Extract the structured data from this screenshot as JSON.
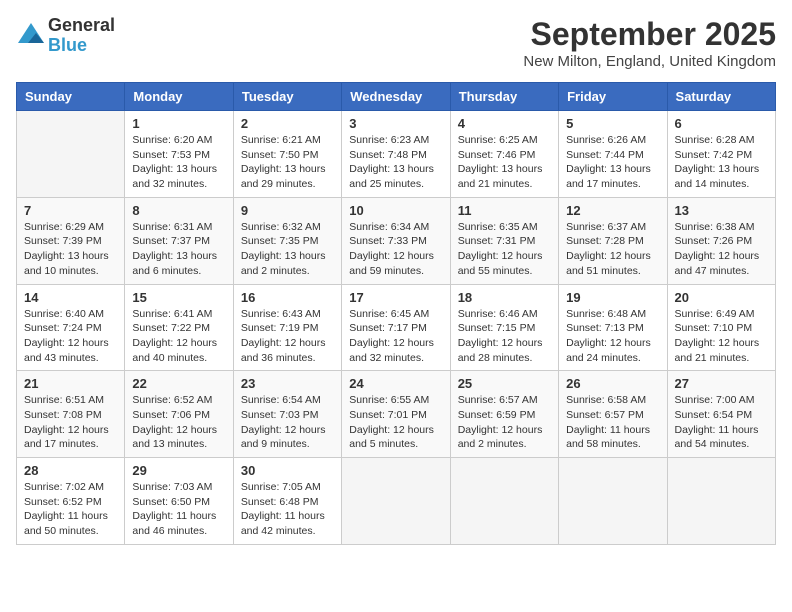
{
  "logo": {
    "general": "General",
    "blue": "Blue"
  },
  "title": "September 2025",
  "subtitle": "New Milton, England, United Kingdom",
  "headers": [
    "Sunday",
    "Monday",
    "Tuesday",
    "Wednesday",
    "Thursday",
    "Friday",
    "Saturday"
  ],
  "weeks": [
    [
      {
        "day": "",
        "info": ""
      },
      {
        "day": "1",
        "info": "Sunrise: 6:20 AM\nSunset: 7:53 PM\nDaylight: 13 hours\nand 32 minutes."
      },
      {
        "day": "2",
        "info": "Sunrise: 6:21 AM\nSunset: 7:50 PM\nDaylight: 13 hours\nand 29 minutes."
      },
      {
        "day": "3",
        "info": "Sunrise: 6:23 AM\nSunset: 7:48 PM\nDaylight: 13 hours\nand 25 minutes."
      },
      {
        "day": "4",
        "info": "Sunrise: 6:25 AM\nSunset: 7:46 PM\nDaylight: 13 hours\nand 21 minutes."
      },
      {
        "day": "5",
        "info": "Sunrise: 6:26 AM\nSunset: 7:44 PM\nDaylight: 13 hours\nand 17 minutes."
      },
      {
        "day": "6",
        "info": "Sunrise: 6:28 AM\nSunset: 7:42 PM\nDaylight: 13 hours\nand 14 minutes."
      }
    ],
    [
      {
        "day": "7",
        "info": "Sunrise: 6:29 AM\nSunset: 7:39 PM\nDaylight: 13 hours\nand 10 minutes."
      },
      {
        "day": "8",
        "info": "Sunrise: 6:31 AM\nSunset: 7:37 PM\nDaylight: 13 hours\nand 6 minutes."
      },
      {
        "day": "9",
        "info": "Sunrise: 6:32 AM\nSunset: 7:35 PM\nDaylight: 13 hours\nand 2 minutes."
      },
      {
        "day": "10",
        "info": "Sunrise: 6:34 AM\nSunset: 7:33 PM\nDaylight: 12 hours\nand 59 minutes."
      },
      {
        "day": "11",
        "info": "Sunrise: 6:35 AM\nSunset: 7:31 PM\nDaylight: 12 hours\nand 55 minutes."
      },
      {
        "day": "12",
        "info": "Sunrise: 6:37 AM\nSunset: 7:28 PM\nDaylight: 12 hours\nand 51 minutes."
      },
      {
        "day": "13",
        "info": "Sunrise: 6:38 AM\nSunset: 7:26 PM\nDaylight: 12 hours\nand 47 minutes."
      }
    ],
    [
      {
        "day": "14",
        "info": "Sunrise: 6:40 AM\nSunset: 7:24 PM\nDaylight: 12 hours\nand 43 minutes."
      },
      {
        "day": "15",
        "info": "Sunrise: 6:41 AM\nSunset: 7:22 PM\nDaylight: 12 hours\nand 40 minutes."
      },
      {
        "day": "16",
        "info": "Sunrise: 6:43 AM\nSunset: 7:19 PM\nDaylight: 12 hours\nand 36 minutes."
      },
      {
        "day": "17",
        "info": "Sunrise: 6:45 AM\nSunset: 7:17 PM\nDaylight: 12 hours\nand 32 minutes."
      },
      {
        "day": "18",
        "info": "Sunrise: 6:46 AM\nSunset: 7:15 PM\nDaylight: 12 hours\nand 28 minutes."
      },
      {
        "day": "19",
        "info": "Sunrise: 6:48 AM\nSunset: 7:13 PM\nDaylight: 12 hours\nand 24 minutes."
      },
      {
        "day": "20",
        "info": "Sunrise: 6:49 AM\nSunset: 7:10 PM\nDaylight: 12 hours\nand 21 minutes."
      }
    ],
    [
      {
        "day": "21",
        "info": "Sunrise: 6:51 AM\nSunset: 7:08 PM\nDaylight: 12 hours\nand 17 minutes."
      },
      {
        "day": "22",
        "info": "Sunrise: 6:52 AM\nSunset: 7:06 PM\nDaylight: 12 hours\nand 13 minutes."
      },
      {
        "day": "23",
        "info": "Sunrise: 6:54 AM\nSunset: 7:03 PM\nDaylight: 12 hours\nand 9 minutes."
      },
      {
        "day": "24",
        "info": "Sunrise: 6:55 AM\nSunset: 7:01 PM\nDaylight: 12 hours\nand 5 minutes."
      },
      {
        "day": "25",
        "info": "Sunrise: 6:57 AM\nSunset: 6:59 PM\nDaylight: 12 hours\nand 2 minutes."
      },
      {
        "day": "26",
        "info": "Sunrise: 6:58 AM\nSunset: 6:57 PM\nDaylight: 11 hours\nand 58 minutes."
      },
      {
        "day": "27",
        "info": "Sunrise: 7:00 AM\nSunset: 6:54 PM\nDaylight: 11 hours\nand 54 minutes."
      }
    ],
    [
      {
        "day": "28",
        "info": "Sunrise: 7:02 AM\nSunset: 6:52 PM\nDaylight: 11 hours\nand 50 minutes."
      },
      {
        "day": "29",
        "info": "Sunrise: 7:03 AM\nSunset: 6:50 PM\nDaylight: 11 hours\nand 46 minutes."
      },
      {
        "day": "30",
        "info": "Sunrise: 7:05 AM\nSunset: 6:48 PM\nDaylight: 11 hours\nand 42 minutes."
      },
      {
        "day": "",
        "info": ""
      },
      {
        "day": "",
        "info": ""
      },
      {
        "day": "",
        "info": ""
      },
      {
        "day": "",
        "info": ""
      }
    ]
  ]
}
